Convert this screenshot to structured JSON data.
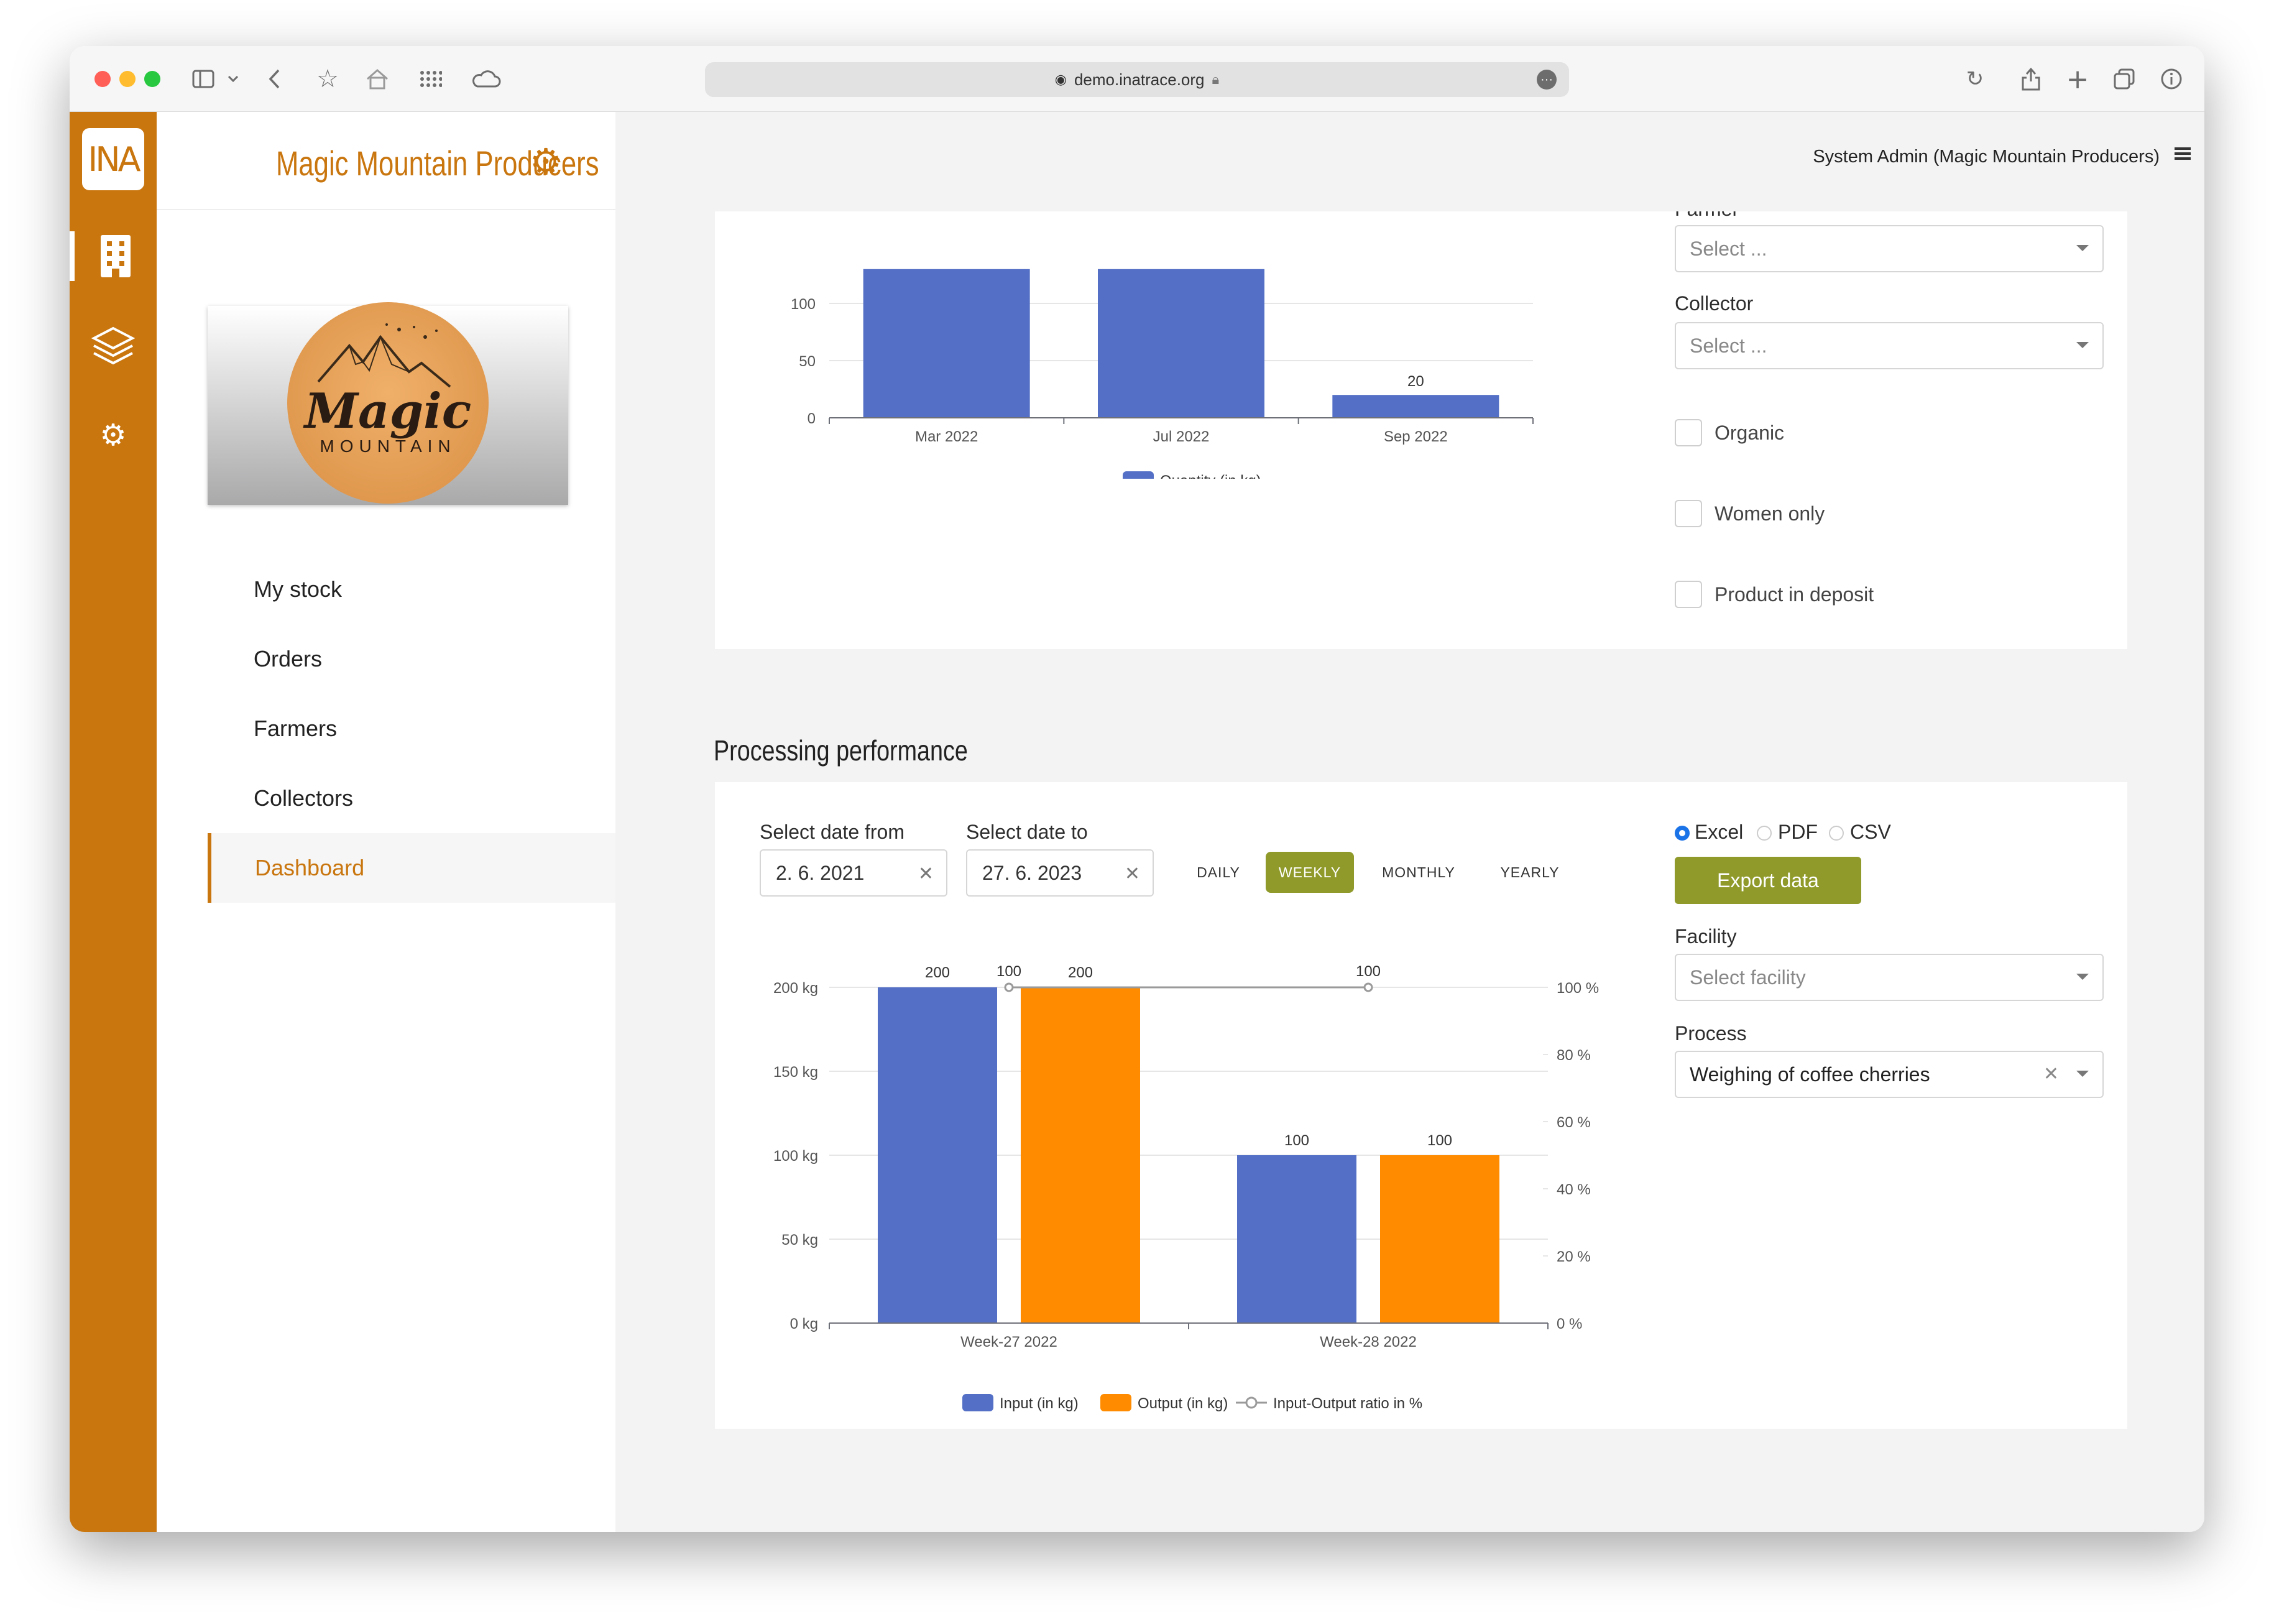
{
  "browser": {
    "url": "demo.inatrace.org"
  },
  "rail": {
    "logo": "INA"
  },
  "sidebar": {
    "company_name": "Magic Mountain Producers",
    "logo_word": "Magic",
    "logo_sub": "MOUNTAIN",
    "nav": [
      {
        "label": "My stock"
      },
      {
        "label": "Orders"
      },
      {
        "label": "Farmers"
      },
      {
        "label": "Collectors"
      },
      {
        "label": "Dashboard"
      }
    ]
  },
  "header": {
    "user": "System Admin (Magic Mountain Producers)"
  },
  "top_section": {
    "farmer_label": "Farmer",
    "farmer_placeholder": "Select ...",
    "collector_label": "Collector",
    "collector_placeholder": "Select ...",
    "checkboxes": [
      "Organic",
      "Women only",
      "Product in deposit"
    ]
  },
  "processing": {
    "title": "Processing performance",
    "date_from_label": "Select date from",
    "date_from": "2. 6. 2021",
    "date_to_label": "Select date to",
    "date_to": "27. 6. 2023",
    "periods": [
      "DAILY",
      "WEEKLY",
      "MONTHLY",
      "YEARLY"
    ],
    "active_period": "WEEKLY",
    "export_formats": [
      "Excel",
      "PDF",
      "CSV"
    ],
    "export_selected": "Excel",
    "export_button": "Export data",
    "facility_label": "Facility",
    "facility_placeholder": "Select facility",
    "process_label": "Process",
    "process_value": "Weighing of coffee cherries"
  },
  "colors": {
    "accent": "#c9760f",
    "blue": "#5470c6",
    "orange": "#ff8c00",
    "olive": "#8f9a2a"
  },
  "chart_data": [
    {
      "type": "bar",
      "categories": [
        "Mar 2022",
        "Jul 2022",
        "Sep 2022"
      ],
      "series": [
        {
          "name": "Quantity (in kg)",
          "values": [
            130,
            130,
            20
          ]
        }
      ],
      "data_labels": [
        "",
        "",
        "20"
      ],
      "yticks": [
        "0",
        "50",
        "100"
      ],
      "ylim": [
        0,
        125
      ],
      "legend": "bottom"
    },
    {
      "type": "bar",
      "categories": [
        "Week-27 2022",
        "Week-28 2022"
      ],
      "series": [
        {
          "name": "Input (in kg)",
          "values": [
            200,
            100
          ]
        },
        {
          "name": "Output (in kg)",
          "values": [
            200,
            100
          ]
        },
        {
          "name": "Input-Output ratio in %",
          "type": "line",
          "values": [
            100,
            100
          ]
        }
      ],
      "bar_labels": [
        "200",
        "200",
        "100",
        "100"
      ],
      "line_labels": [
        "100",
        "100"
      ],
      "yticks_left": [
        "0 kg",
        "50 kg",
        "100 kg",
        "150 kg",
        "200 kg"
      ],
      "yticks_right": [
        "0 %",
        "20 %",
        "40 %",
        "60 %",
        "80 %",
        "100 %"
      ],
      "ylim_left": [
        0,
        200
      ],
      "ylim_right": [
        0,
        100
      ],
      "legend": "bottom"
    }
  ]
}
